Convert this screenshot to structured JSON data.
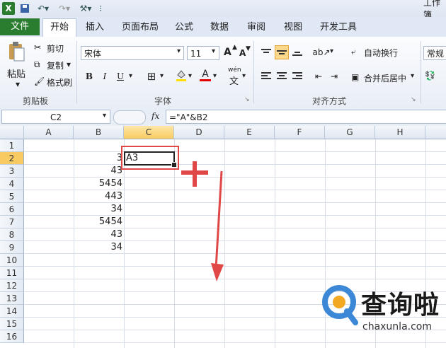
{
  "titlebar": {
    "app_icon": "excel-icon",
    "title": "工作簿"
  },
  "tabs": {
    "file": "文件",
    "items": [
      "开始",
      "插入",
      "页面布局",
      "公式",
      "数据",
      "审阅",
      "视图",
      "开发工具"
    ]
  },
  "ribbon": {
    "clipboard": {
      "paste": "粘贴",
      "cut": "剪切",
      "copy": "复制",
      "format_painter": "格式刷",
      "label": "剪贴板"
    },
    "font": {
      "name": "宋体",
      "size": "11",
      "bold": "B",
      "italic": "I",
      "underline": "U",
      "grow": "A",
      "shrink": "A",
      "font_color": "A",
      "wen": "wén",
      "label": "字体"
    },
    "alignment": {
      "wrap": "自动换行",
      "merge": "合并后居中",
      "label": "对齐方式"
    },
    "number": {
      "format": "常规"
    }
  },
  "formulabar": {
    "namebox": "C2",
    "fx": "fx",
    "formula": "=\"A\"&B2"
  },
  "sheet": {
    "columns": [
      "A",
      "B",
      "C",
      "D",
      "E",
      "F",
      "G",
      "H"
    ],
    "rows": [
      "1",
      "2",
      "3",
      "4",
      "5",
      "6",
      "7",
      "8",
      "9",
      "10",
      "11",
      "12",
      "13",
      "14",
      "15",
      "16"
    ],
    "b_values": [
      "3",
      "43",
      "5454",
      "443",
      "34",
      "5454",
      "43",
      "34"
    ],
    "c2": "A3"
  },
  "watermark": {
    "brand": "查询啦",
    "url": "chaxunla.com"
  },
  "colors": {
    "file_tab": "#2a7d2e",
    "selection": "#f8cb62",
    "annotation": "#e04848"
  }
}
